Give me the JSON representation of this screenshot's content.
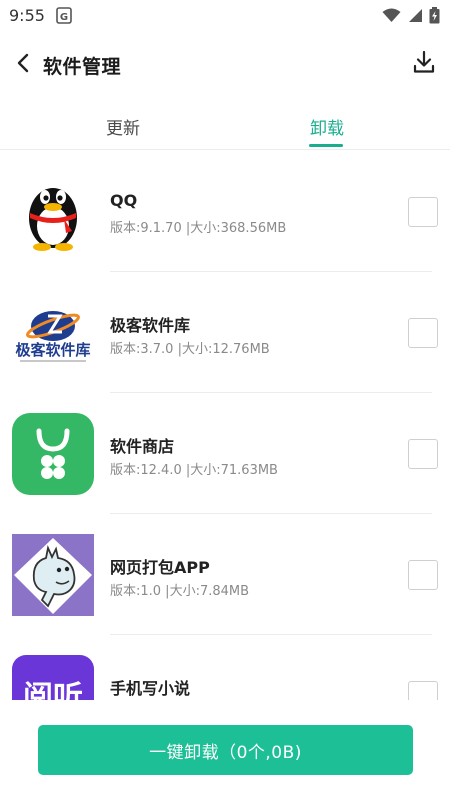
{
  "status_bar": {
    "time": "9:55",
    "notification_icon": "app-notification-icon",
    "icons": [
      "wifi-icon",
      "signal-icon",
      "battery-icon"
    ]
  },
  "header": {
    "back_icon": "chevron-left-icon",
    "title": "软件管理",
    "download_icon": "download-icon"
  },
  "tabs": [
    {
      "label": "更新",
      "active": false
    },
    {
      "label": "卸载",
      "active": true
    }
  ],
  "accent_color": "#1aae8f",
  "apps": [
    {
      "name": "QQ",
      "version": "版本:9.1.70 |大小:368.56MB",
      "icon": "qq-penguin-icon",
      "checked": false
    },
    {
      "name": "极客软件库",
      "version": "版本:3.7.0 |大小:12.76MB",
      "icon": "geek-library-logo-icon",
      "checked": false
    },
    {
      "name": "软件商店",
      "version": "版本:12.4.0 |大小:71.63MB",
      "icon": "software-store-bag-icon",
      "checked": false
    },
    {
      "name": "网页打包APP",
      "version": "版本:1.0 |大小:7.84MB",
      "icon": "web-packager-moomin-icon",
      "checked": false
    },
    {
      "name": "手机写小说",
      "version": "",
      "icon": "novel-writer-icon",
      "checked": false
    }
  ],
  "icon_texts": {
    "geek_logo": "极客软件库",
    "novel_app": "阅听"
  },
  "uninstall_button": {
    "label": "一键卸载（0个,0B)"
  }
}
